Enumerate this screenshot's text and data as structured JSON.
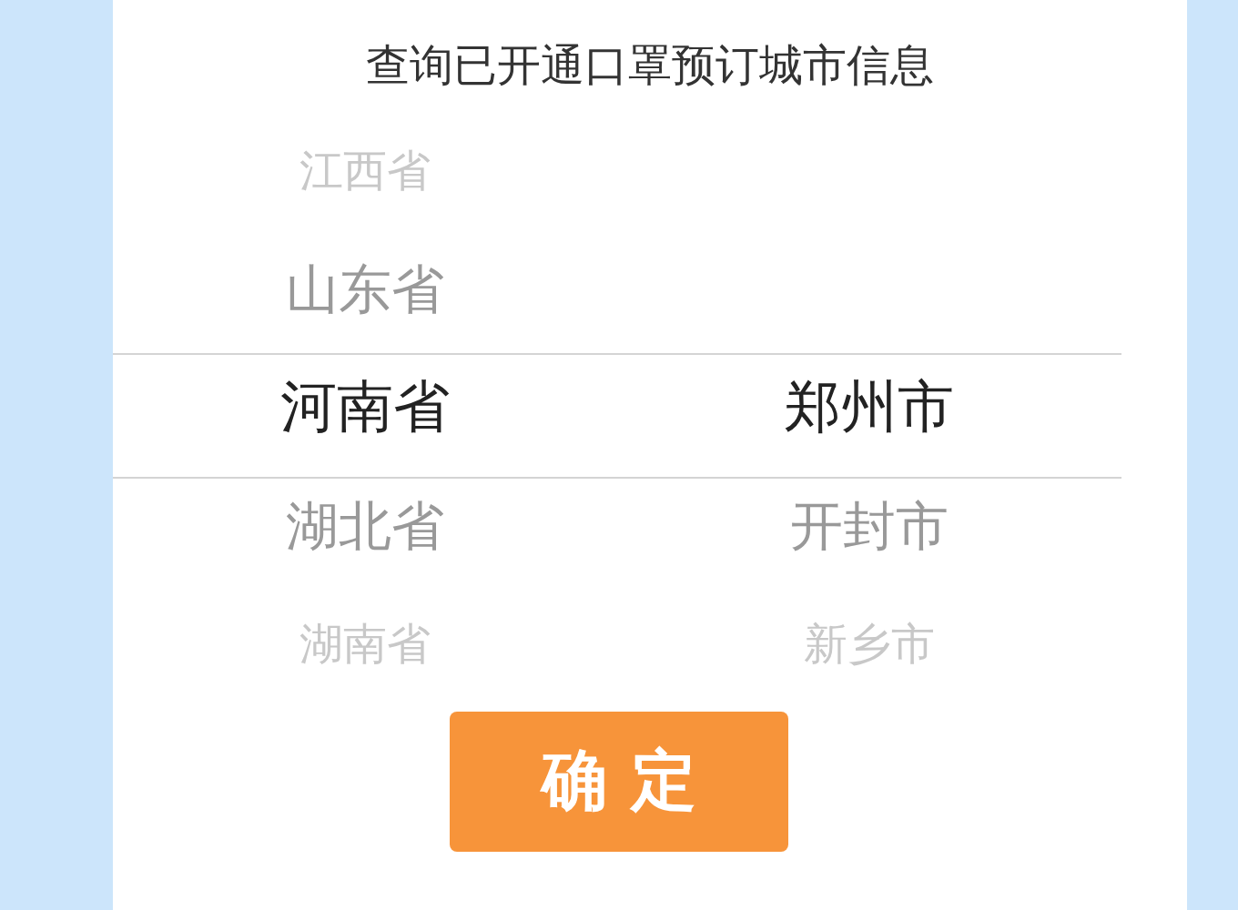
{
  "title": "查询已开通口罩预订城市信息",
  "picker": {
    "columns": [
      {
        "items": [
          {
            "label": "江西省",
            "selected": false
          },
          {
            "label": "山东省",
            "selected": false
          },
          {
            "label": "河南省",
            "selected": true
          },
          {
            "label": "湖北省",
            "selected": false
          },
          {
            "label": "湖南省",
            "selected": false
          }
        ]
      },
      {
        "items": [
          {
            "label": "郑州市",
            "selected": true
          },
          {
            "label": "开封市",
            "selected": false
          },
          {
            "label": "新乡市",
            "selected": false
          }
        ]
      }
    ]
  },
  "confirm_button": "确 定"
}
